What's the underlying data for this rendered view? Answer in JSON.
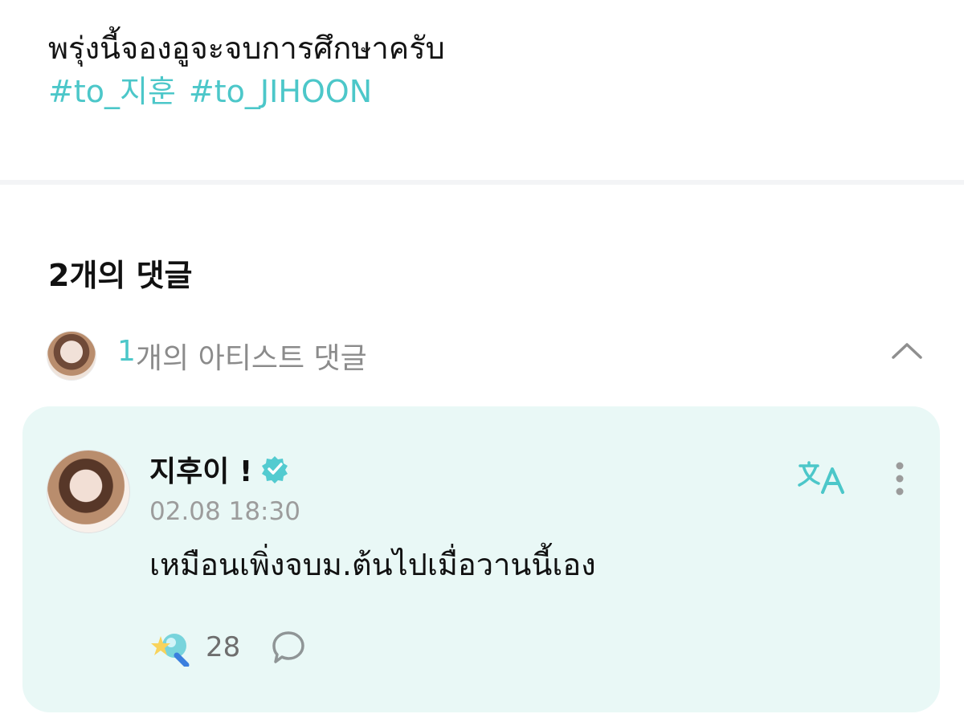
{
  "post": {
    "text": "พรุ่งนี้จองอูจะจบการศึกษาครับ",
    "hashtags": [
      "#to_지훈",
      "#to_JIHOON"
    ]
  },
  "comments": {
    "count_label": "2개의 댓글",
    "artist_summary": {
      "count": "1",
      "suffix": "개의 아티스트 댓글"
    }
  },
  "comment": {
    "author": "지후이 !",
    "timestamp": "02.08 18:30",
    "text": "เหมือนเพิ่งจบม.ต้นไปเมื่อวานนี้เอง",
    "like_count": "28"
  },
  "colors": {
    "accent": "#4cc7c9",
    "card_background": "#e9f8f6",
    "muted_text": "#9c9c9c"
  },
  "icons": {
    "collapse": "chevron-up-icon",
    "verified": "verified-badge-icon",
    "translate": "translate-icon",
    "more": "more-vertical-icon",
    "like": "star-wand-like-icon",
    "reply": "speech-bubble-icon"
  }
}
